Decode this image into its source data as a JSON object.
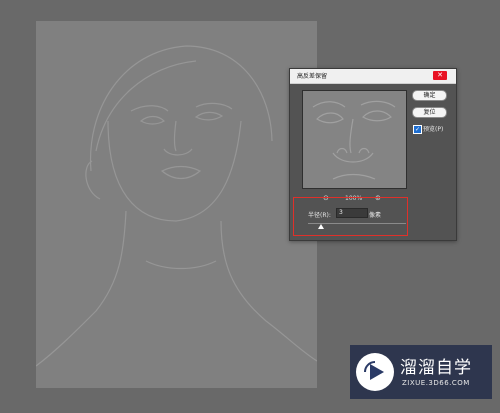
{
  "dialog": {
    "title": "高反差保留",
    "close_glyph": "✕",
    "ok_label": "确定",
    "reset_label": "复位",
    "preview_checked": true,
    "preview_label": "预览(P)",
    "zoom_out_glyph": "⊖",
    "zoom_level": "100%",
    "zoom_in_glyph": "⊕",
    "radius_label": "半径(R):",
    "radius_value": "3",
    "radius_unit": "像素"
  },
  "watermark": {
    "brand": "溜溜自学",
    "url": "ZIXUE.3D66.COM"
  },
  "colors": {
    "canvas_gray": "#808080",
    "workspace": "#696969",
    "dialog_bg": "#535353",
    "highlight_red": "#e0302a",
    "watermark_bg": "#1e2846"
  }
}
